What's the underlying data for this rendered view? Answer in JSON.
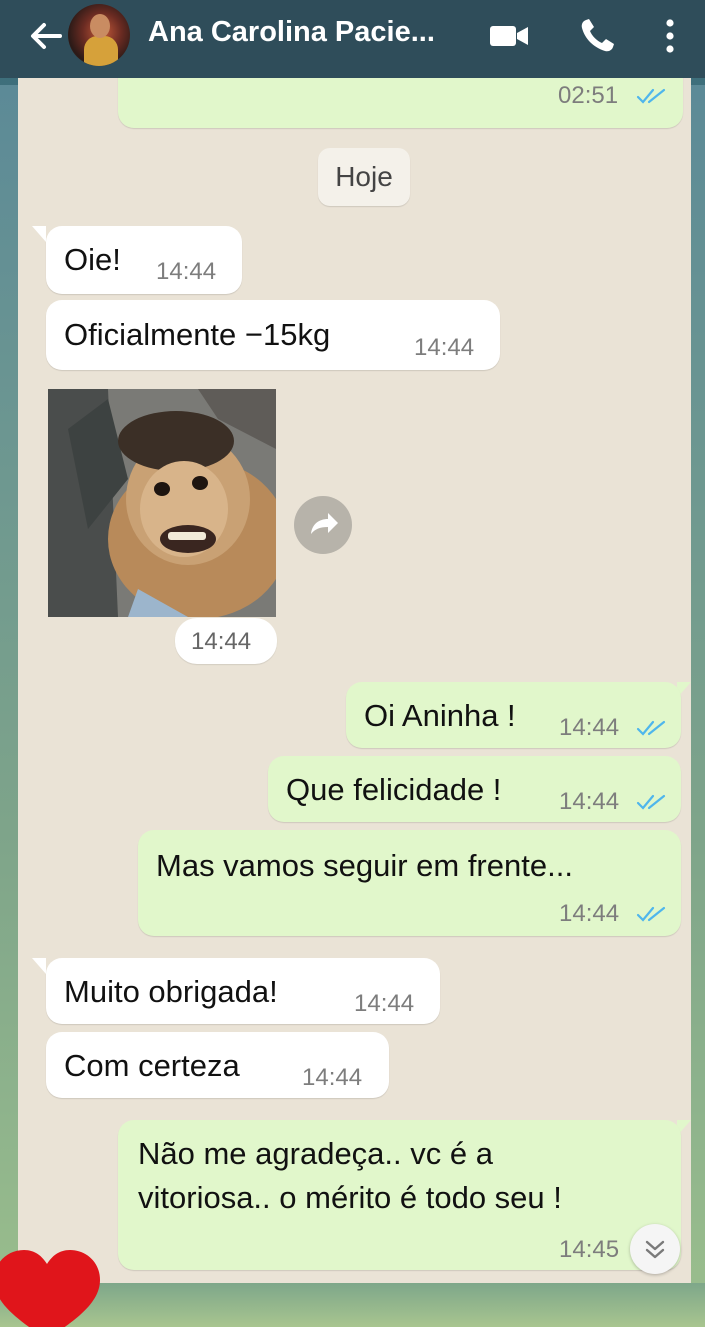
{
  "header": {
    "contact_name": "Ana Carolina Pacie...",
    "back_icon": "arrow-left-icon",
    "video_icon": "video-camera-icon",
    "call_icon": "phone-icon",
    "more_icon": "more-vertical-icon"
  },
  "chat": {
    "prev_time": "02:51",
    "date_label": "Hoje",
    "messages": [
      {
        "dir": "in",
        "text": "Oie!",
        "time": "14:44"
      },
      {
        "dir": "in",
        "text": "Oficialmente −15kg",
        "time": "14:44"
      },
      {
        "dir": "in",
        "type": "image",
        "time": "14:44"
      },
      {
        "dir": "out",
        "text": "Oi Aninha !",
        "time": "14:44",
        "read": true
      },
      {
        "dir": "out",
        "text": "Que felicidade !",
        "time": "14:44",
        "read": true
      },
      {
        "dir": "out",
        "text": "Mas vamos seguir em frente...",
        "time": "14:44",
        "read": true
      },
      {
        "dir": "in",
        "text": "Muito obrigada!",
        "time": "14:44"
      },
      {
        "dir": "in",
        "text": "Com certeza",
        "time": "14:44"
      },
      {
        "dir": "out",
        "lines": [
          "Não me agradeça.. vc é a",
          "vitoriosa.. o mérito é todo seu !"
        ],
        "time": "14:45"
      }
    ]
  },
  "colors": {
    "header_bg": "#2f4d5a",
    "chat_bg": "#eae3d6",
    "incoming_bubble": "#ffffff",
    "outgoing_bubble": "#e1f7cb",
    "read_ticks": "#4fb6ec",
    "heart": "#e0151b"
  }
}
